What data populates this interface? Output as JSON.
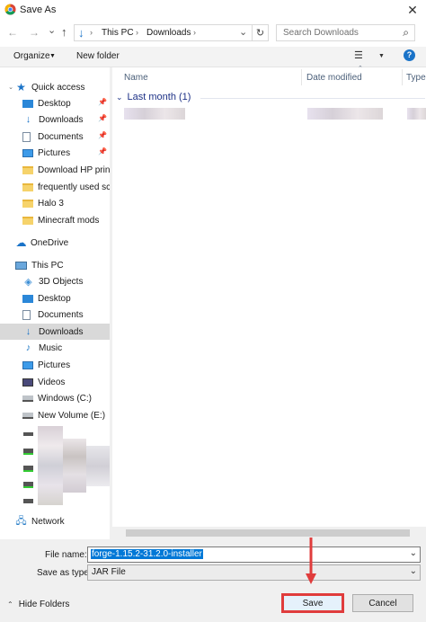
{
  "window": {
    "title": "Save As",
    "close_glyph": "✕"
  },
  "nav": {
    "back_glyph": "←",
    "forward_glyph": "→",
    "dropdown_glyph": "⌄",
    "up_glyph": "↑",
    "breadcrumb": [
      "This PC",
      "Downloads"
    ],
    "separator": "›",
    "search_placeholder": "Search Downloads",
    "refresh_glyph": "↻",
    "search_glyph": "⌕"
  },
  "toolbar": {
    "organize": "Organize",
    "new_folder": "New folder",
    "help": "?"
  },
  "sidebar": {
    "quick_access": "Quick access",
    "quick_items": [
      "Desktop",
      "Downloads",
      "Documents",
      "Pictures",
      "Download HP printe",
      "frequently used scre",
      "Halo 3",
      "Minecraft mods"
    ],
    "onedrive": "OneDrive",
    "this_pc": "This PC",
    "pc_items": [
      "3D Objects",
      "Desktop",
      "Documents",
      "Downloads",
      "Music",
      "Pictures",
      "Videos",
      "Windows (C:)",
      "New Volume (E:)"
    ],
    "network": "Network"
  },
  "columns": {
    "name": "Name",
    "date": "Date modified",
    "type": "Type"
  },
  "group": {
    "label": "Last month (1)"
  },
  "form": {
    "filename_label": "File name:",
    "filename_value": "forge-1.15.2-31.2.0-installer",
    "type_label": "Save as type:",
    "type_value": "JAR File"
  },
  "footer": {
    "hide_folders": "Hide Folders",
    "save": "Save",
    "cancel": "Cancel"
  },
  "colors": {
    "accent": "#0078d7",
    "highlight": "#e03c3c",
    "selection": "#0078d7"
  }
}
